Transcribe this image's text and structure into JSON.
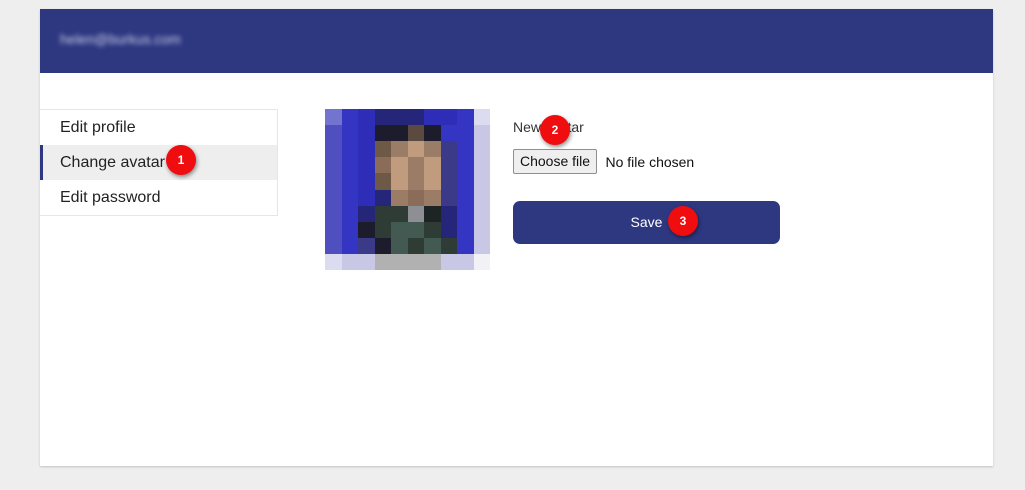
{
  "header": {
    "email": "helen@burkus.com"
  },
  "sidebar": {
    "items": [
      {
        "label": "Edit profile"
      },
      {
        "label": "Change avatar",
        "active": true
      },
      {
        "label": "Edit password"
      }
    ]
  },
  "form": {
    "new_avatar_label": "New avatar",
    "choose_file_label": "Choose file",
    "file_status": "No file chosen",
    "save_label": "Save"
  },
  "annotations": {
    "badge1": "1",
    "badge2": "2",
    "badge3": "3",
    "color": "#ef0d10"
  },
  "colors": {
    "brand": "#2e3881",
    "page_background": "#eeeeee",
    "active_item_background": "#eeeeee"
  }
}
